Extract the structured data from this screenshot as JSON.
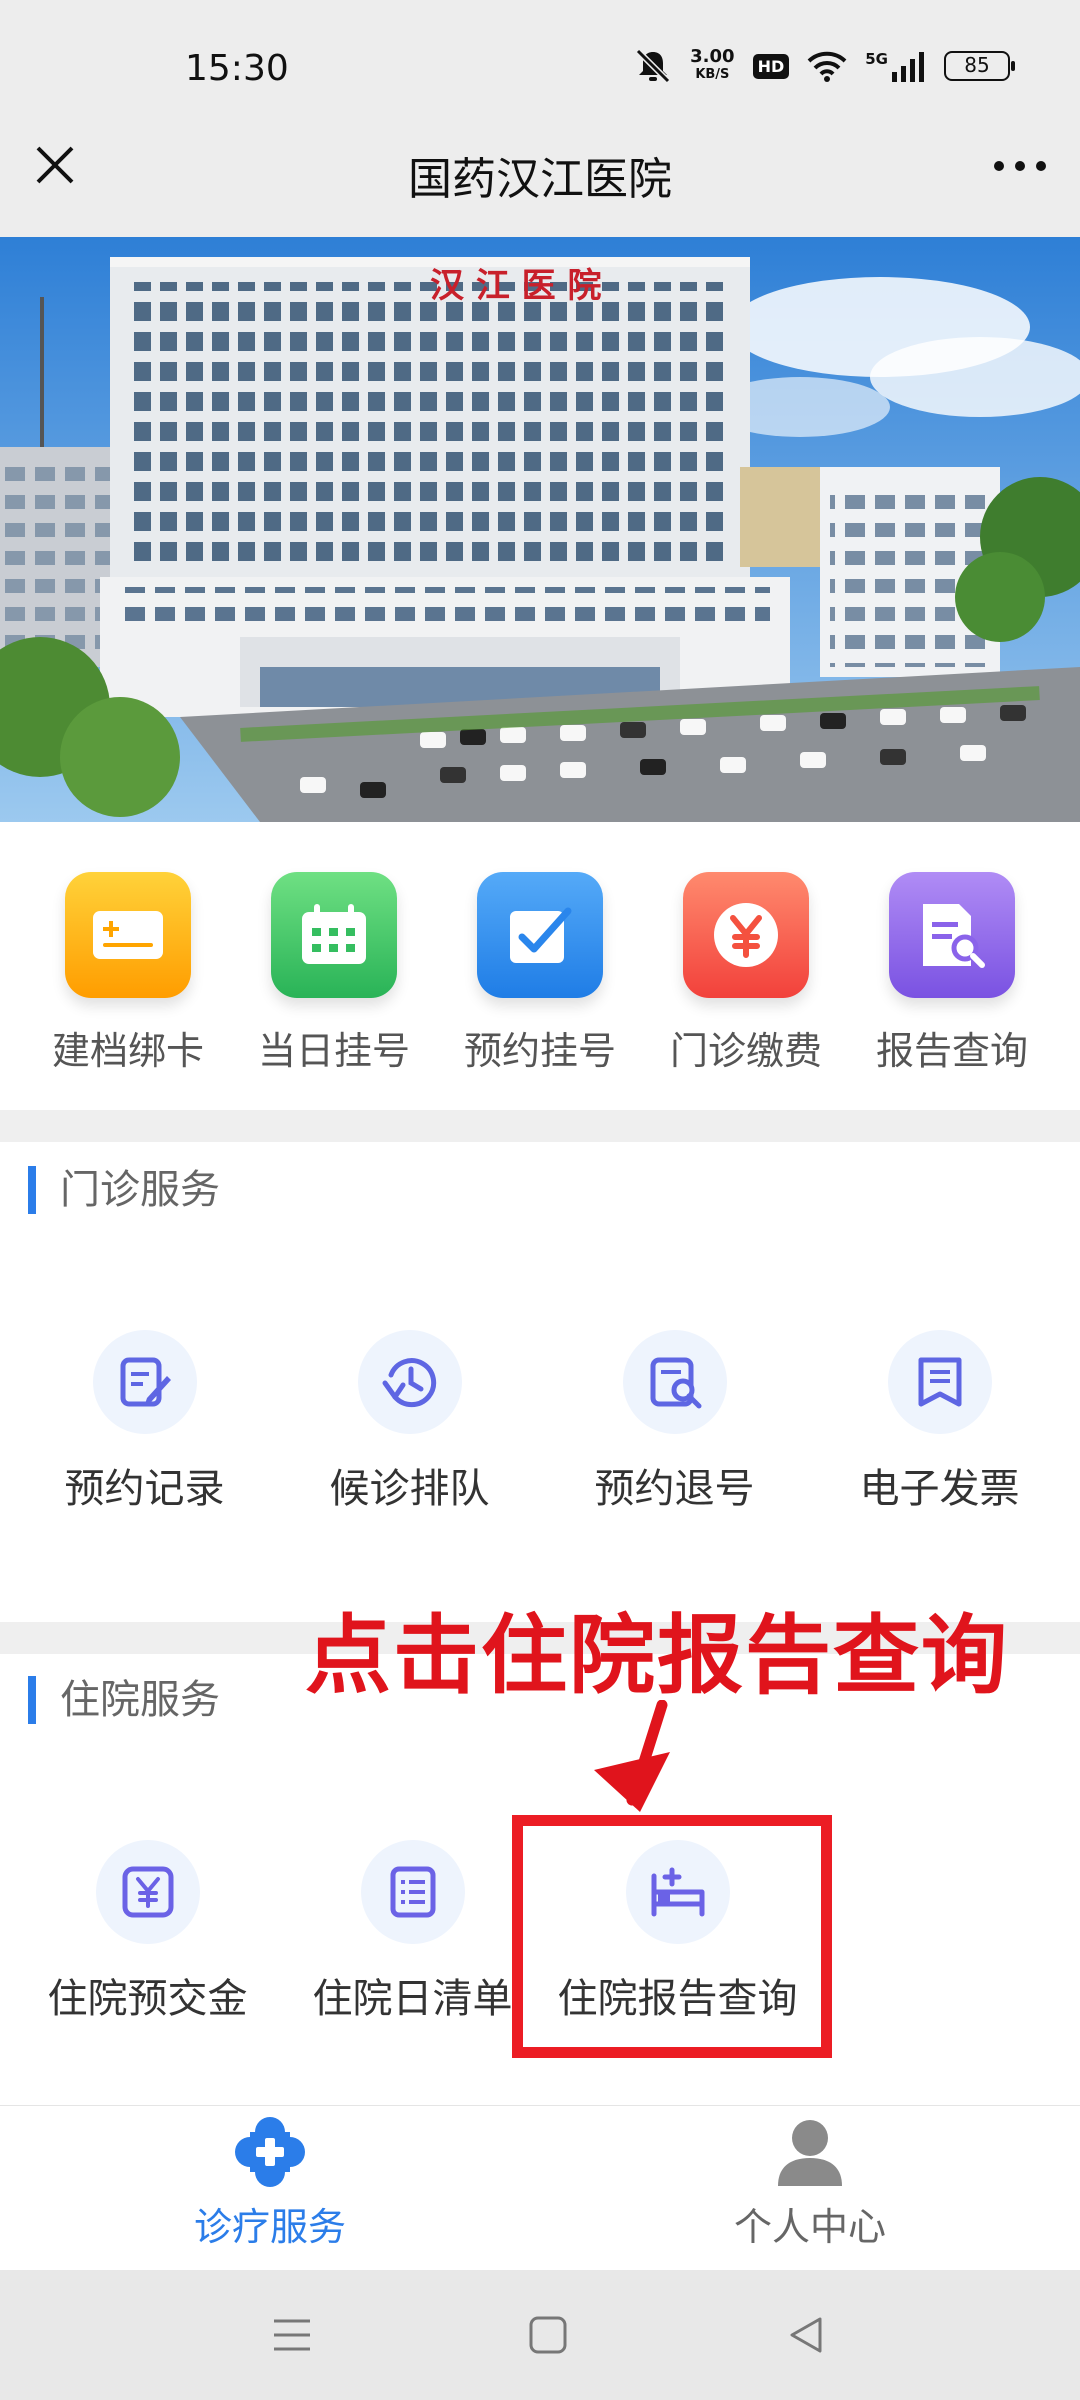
{
  "status_bar": {
    "time": "15:30",
    "speed_value": "3.00",
    "speed_unit": "KB/S",
    "hd": "HD",
    "network": "5G",
    "battery": "85"
  },
  "header": {
    "title": "国药汉江医院"
  },
  "banner": {
    "sign_text": "汉 江 医 院"
  },
  "quick_menu": [
    {
      "label": "建档绑卡",
      "icon": "card-icon",
      "color": "#ffb000"
    },
    {
      "label": "当日挂号",
      "icon": "calendar-icon",
      "color": "#3ec46d"
    },
    {
      "label": "预约挂号",
      "icon": "checkbox-icon",
      "color": "#2f8ef0"
    },
    {
      "label": "门诊缴费",
      "icon": "yuan-icon",
      "color": "#fb5a4a"
    },
    {
      "label": "报告查询",
      "icon": "report-search-icon",
      "color": "#8a63ea"
    }
  ],
  "outpatient": {
    "title": "门诊服务",
    "items": [
      {
        "label": "预约记录",
        "icon": "edit-record-icon"
      },
      {
        "label": "候诊排队",
        "icon": "clock-icon"
      },
      {
        "label": "预约退号",
        "icon": "document-search-icon"
      },
      {
        "label": "电子发票",
        "icon": "bookmark-icon"
      }
    ]
  },
  "inpatient": {
    "title": "住院服务",
    "items": [
      {
        "label": "住院预交金",
        "icon": "yuan-icon"
      },
      {
        "label": "住院日清单",
        "icon": "list-icon"
      },
      {
        "label": "住院报告查询",
        "icon": "hospital-bed-icon"
      }
    ]
  },
  "annotation": {
    "text": "点击住院报告查询"
  },
  "bottom_nav": [
    {
      "label": "诊疗服务",
      "icon": "medical-cross-icon",
      "active": true
    },
    {
      "label": "个人中心",
      "icon": "person-icon",
      "active": false
    }
  ],
  "colors": {
    "accent": "#2b7de9",
    "annotation": "#e0141c",
    "icon_purple": "#6b62e6"
  }
}
